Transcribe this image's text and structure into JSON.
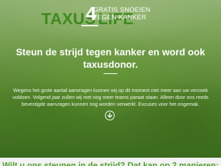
{
  "logo": {
    "taxus": "TAXUS",
    "four": "4",
    "life": "LIFE"
  },
  "tagline": {
    "line1": "GRATIS SNOEIEN",
    "line2": "TEGEN KANKER"
  },
  "hero": {
    "headline": "Steun de strijd tegen kanker en word ook taxusdonor.",
    "body": "Wegens het grote aantal aanvragen kunnen wij op dit moment niet meer aan uw verzoek voldoen. Volgend jaar zullen wij met nog meer teams paraat staan. Alleen door ons reeds bevestigde aanvragen kunnen nog worden verwerkt. Excuses voor het ongemak."
  },
  "icons": {
    "scroll_down": "arrow-down-circle-icon"
  },
  "section": {
    "heading": "Wilt u ons steunen in de strijd? Dat kan op 2 manieren:"
  },
  "colors": {
    "brand_green": "#3d8a1e",
    "heading_green": "#4ea12b",
    "white": "#ffffff"
  }
}
